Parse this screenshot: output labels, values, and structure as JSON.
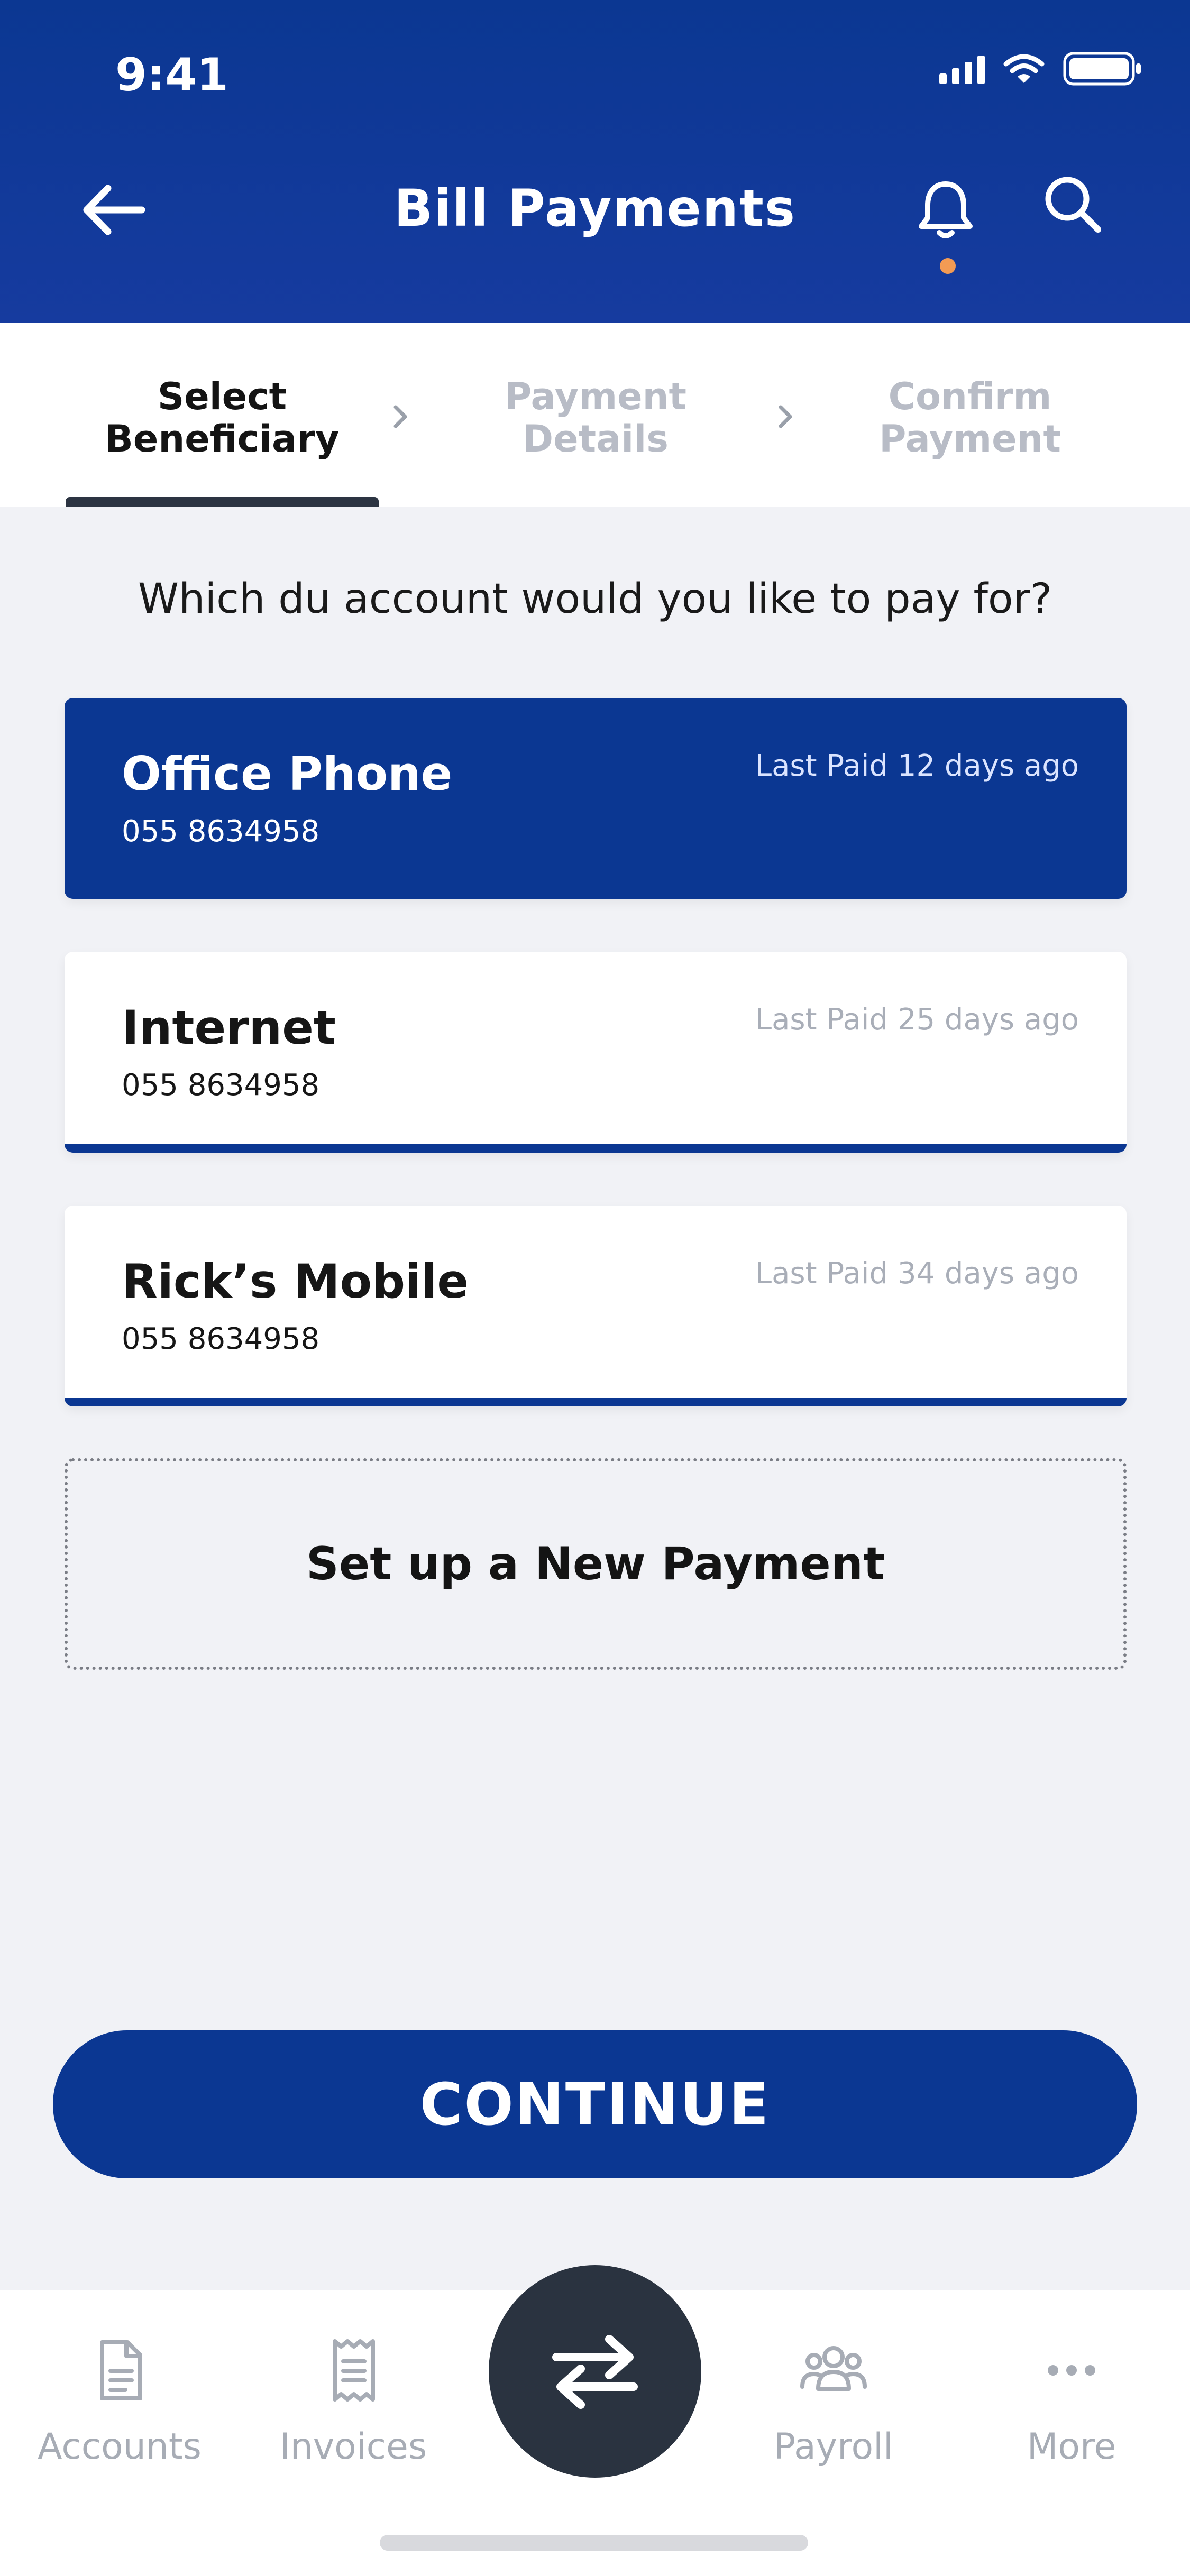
{
  "status_bar": {
    "time": "9:41"
  },
  "header": {
    "title": "Bill Payments"
  },
  "steps": [
    {
      "line1": "Select",
      "line2": "Beneficiary",
      "state": "active"
    },
    {
      "line1": "Payment",
      "line2": "Details",
      "state": "inactive"
    },
    {
      "line1": "Confirm",
      "line2": "Payment",
      "state": "inactive"
    }
  ],
  "question": "Which du account would you like to pay for?",
  "accounts": [
    {
      "name": "Office Phone",
      "number": "055 8634958",
      "last_paid": "Last Paid 12 days ago",
      "selected": true
    },
    {
      "name": "Internet",
      "number": "055 8634958",
      "last_paid": "Last Paid 25 days ago",
      "selected": false
    },
    {
      "name": "Rick’s Mobile",
      "number": "055 8634958",
      "last_paid": "Last Paid 34 days ago",
      "selected": false
    }
  ],
  "new_payment_label": "Set up a New Payment",
  "continue_label": "CONTINUE",
  "bottom_nav": [
    {
      "label": "Accounts",
      "icon": "document-icon"
    },
    {
      "label": "Invoices",
      "icon": "receipt-icon"
    },
    {
      "label": "",
      "icon": "transfer-icon"
    },
    {
      "label": "Payroll",
      "icon": "people-icon"
    },
    {
      "label": "More",
      "icon": "dots-icon"
    }
  ],
  "colors": {
    "primary": "#0b3792",
    "accent_dot": "#f29b54",
    "nav_center": "#2a3340",
    "background": "#f1f2f6"
  }
}
